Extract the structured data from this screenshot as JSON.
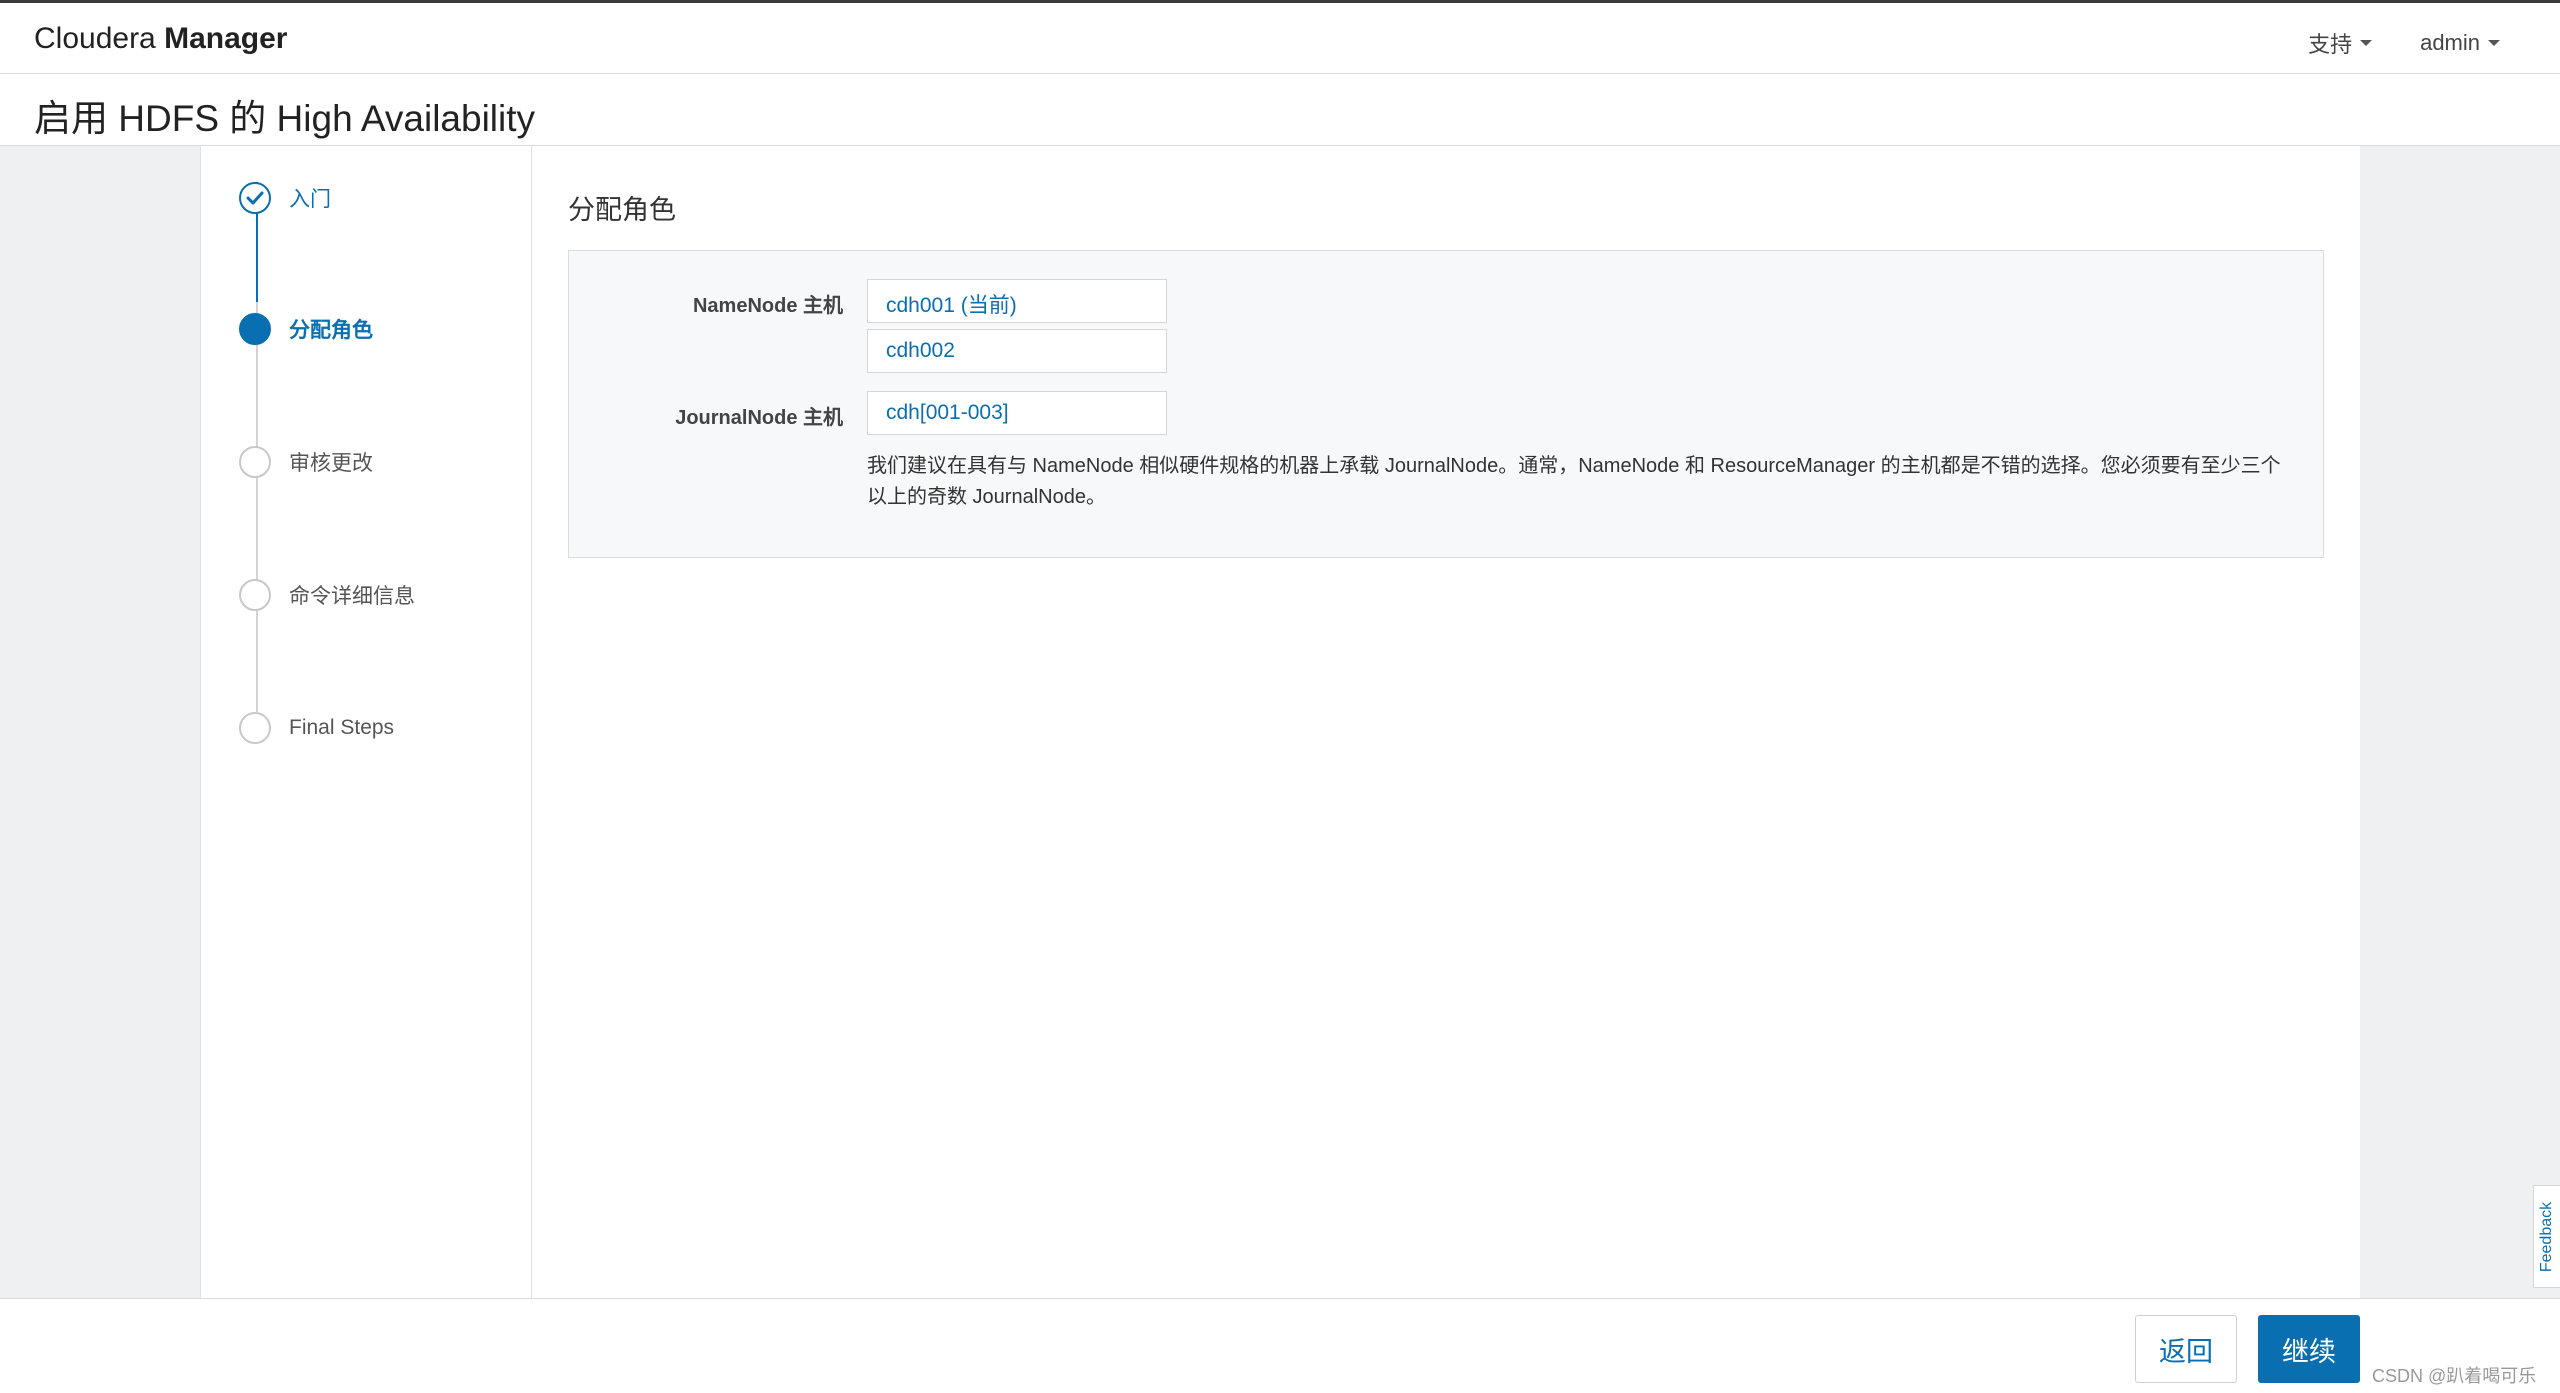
{
  "app": {
    "brand_light": "Cloudera",
    "brand_bold": "Manager"
  },
  "nav": {
    "support": "支持",
    "user": "admin"
  },
  "page": {
    "title": "启用 HDFS 的 High Availability"
  },
  "wizard": {
    "steps": [
      {
        "label": "入门",
        "state": "done"
      },
      {
        "label": "分配角色",
        "state": "active"
      },
      {
        "label": "审核更改",
        "state": "pending"
      },
      {
        "label": "命令详细信息",
        "state": "pending"
      },
      {
        "label": "Final Steps",
        "state": "pending"
      }
    ]
  },
  "main": {
    "section_title": "分配角色",
    "namenode_label": "NameNode 主机",
    "namenode_hosts": [
      "cdh001 (当前)",
      "cdh002"
    ],
    "journalnode_label": "JournalNode 主机",
    "journalnode_hosts": "cdh[001-003]",
    "help_text": "我们建议在具有与 NameNode 相似硬件规格的机器上承载 JournalNode。通常，NameNode 和 ResourceManager 的主机都是不错的选择。您必须要有至少三个以上的奇数 JournalNode。"
  },
  "footer": {
    "back": "返回",
    "next": "继续"
  },
  "feedback": "Feedback",
  "watermark": "CSDN @趴着喝可乐",
  "colors": {
    "accent": "#0a6fb0",
    "content_bg": "#eef0f2",
    "panel_bg": "#f7f8f9"
  }
}
